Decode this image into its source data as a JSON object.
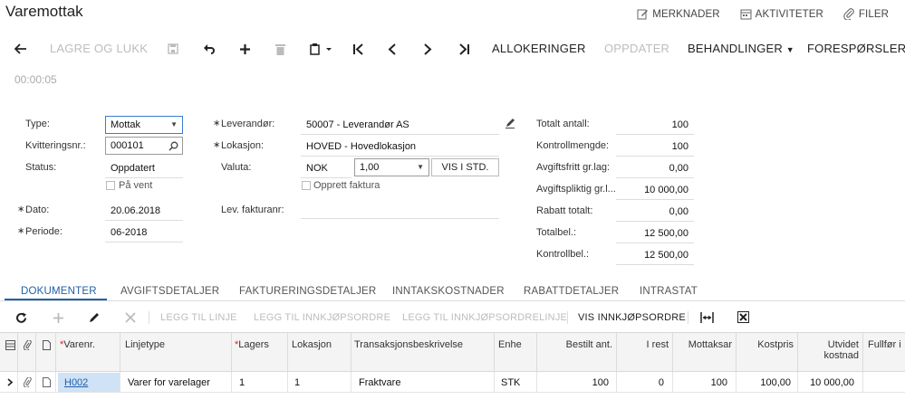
{
  "header": {
    "title": "Varemottak",
    "links": [
      {
        "label": "MERKNADER",
        "icon": "note-edit-icon"
      },
      {
        "label": "AKTIVITETER",
        "icon": "calendar-icon"
      },
      {
        "label": "FILER",
        "icon": "paperclip-icon"
      }
    ]
  },
  "toolbar": {
    "save_close": "LAGRE OG LUKK",
    "allokeringer": "ALLOKERINGER",
    "oppdater": "OPPDATER",
    "behandlinger": "BEHANDLINGER",
    "foresporsler": "FORESPØRSLER"
  },
  "timer": "00:00:05",
  "form": {
    "type_label": "Type:",
    "type_value": "Mottak",
    "receipt_label": "Kvitteringsnr.:",
    "receipt_value": "000101",
    "status_label": "Status:",
    "status_value": "Oppdatert",
    "on_hold_label": "På vent",
    "date_label": "Dato:",
    "date_value": "20.06.2018",
    "period_label": "Periode:",
    "period_value": "06-2018",
    "vendor_label": "Leverandør:",
    "vendor_value": "50007 - Leverandør AS",
    "location_label": "Lokasjon:",
    "location_value": "HOVED - Hovedlokasjon",
    "currency_label": "Valuta:",
    "currency_code": "NOK",
    "currency_rate": "1,00",
    "currency_button": "VIS I STD.",
    "create_invoice_label": "Opprett faktura",
    "vendor_invoice_label": "Lev. fakturanr:",
    "vendor_invoice_value": ""
  },
  "totals": [
    {
      "label": "Totalt antall:",
      "value": "100"
    },
    {
      "label": "Kontrollmengde:",
      "value": "100"
    },
    {
      "label": "Avgiftsfritt gr.lag:",
      "value": "0,00"
    },
    {
      "label": "Avgiftspliktig gr.l...",
      "value": "10 000,00"
    },
    {
      "label": "Rabatt totalt:",
      "value": "0,00"
    },
    {
      "label": "Totalbel.:",
      "value": "12 500,00"
    },
    {
      "label": "Kontrollbel.:",
      "value": "12 500,00"
    }
  ],
  "tabs": [
    "DOKUMENTER",
    "AVGIFTSDETALJER",
    "FAKTURERINGSDETALJER",
    "INNTAKSKOSTNADER",
    "RABATTDETALJER",
    "INTRASTAT"
  ],
  "grid_toolbar": {
    "add_line": "LEGG TIL LINJE",
    "add_po": "LEGG TIL INNKJØPSORDRE",
    "add_po_line": "LEGG TIL INNKJØPSORDRELINJE",
    "view_po": "VIS INNKJØPSORDRE"
  },
  "grid": {
    "columns": [
      "Varenr.",
      "Linjetype",
      "Lagers",
      "Lokasjon",
      "Transaksjonsbeskrivelse",
      "Enhe",
      "Bestilt ant.",
      "I rest",
      "Mottaksar",
      "Kostpris",
      "Utvidet kostnad",
      "Fullfør i"
    ],
    "rows": [
      {
        "item": "H002",
        "line_type": "Varer for varelager",
        "warehouse": "1",
        "location": "1",
        "description": "Fraktvare",
        "uom": "STK",
        "ordered": "100",
        "open": "0",
        "received": "100",
        "cost": "100,00",
        "ext_cost": "10 000,00",
        "complete": ""
      }
    ]
  },
  "colors": {
    "accent": "#1f5fa8",
    "selected_cell": "#cfe2f6"
  }
}
